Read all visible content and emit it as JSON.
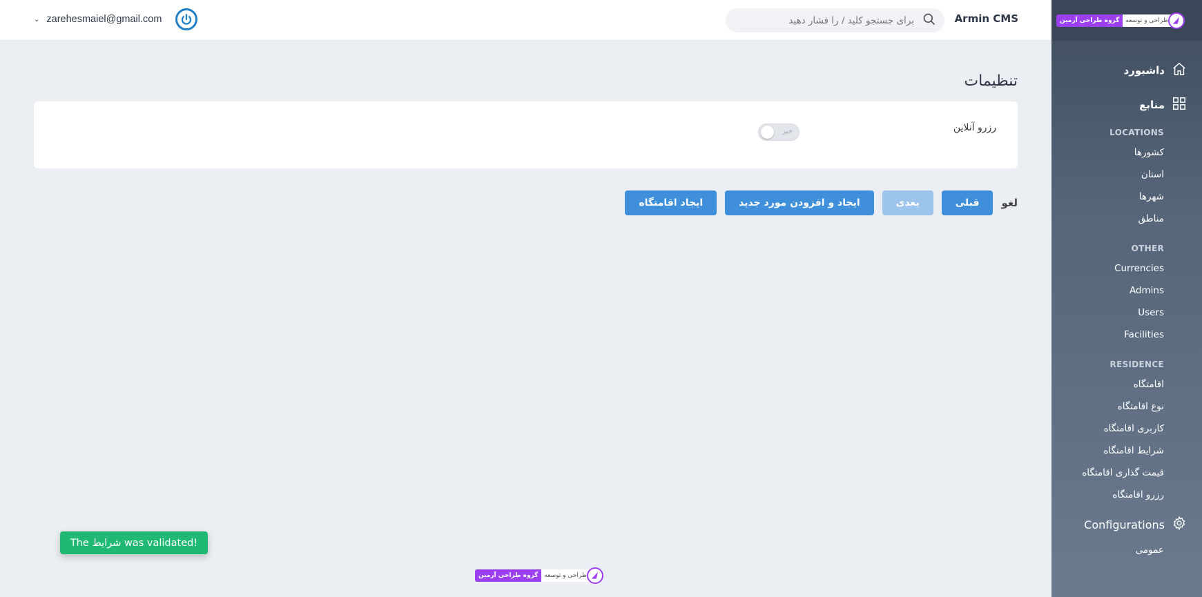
{
  "header": {
    "brand": "Armin CMS",
    "search_placeholder": "برای جستجو کلید / را فشار دهید",
    "user_email": "zarehesmaiel@gmail.com"
  },
  "sidebar": {
    "logo": {
      "purple_text": "گروه طراحی آرمین",
      "white_text": "طراحی و توسعه"
    },
    "dashboard": "داشبورد",
    "resources": "منابع",
    "sections": [
      {
        "title": "LOCATIONS",
        "items": [
          "کشورها",
          "استان",
          "شهرها",
          "مناطق"
        ]
      },
      {
        "title": "OTHER",
        "items": [
          "Currencies",
          "Admins",
          "Users",
          "Facilities"
        ]
      },
      {
        "title": "RESIDENCE",
        "items": [
          "اقامتگاه",
          "نوع اقامتگاه",
          "کاربری اقامتگاه",
          "شرایط اقامتگاه",
          "قیمت گذاری اقامتگاه",
          "رزرو اقامتگاه"
        ]
      }
    ],
    "configurations": "Configurations",
    "general": "عمومی"
  },
  "main": {
    "title": "تنظیمات",
    "field_label": "رزرو آنلاین",
    "toggle_label": "خیر",
    "toggle_on": false,
    "actions": {
      "cancel": "لغو",
      "previous": "قبلی",
      "next": "بعدی",
      "create_and_add": "ایجاد و افزودن مورد جدید",
      "create": "ایجاد اقامتگاه"
    }
  },
  "toast": "The شرایط was validated!",
  "footer_logo": {
    "purple_text": "گروه طراحی آرمین",
    "white_text": "طراحی و توسعه"
  },
  "colors": {
    "primary": "#3f8fdb",
    "success": "#1fb974",
    "sidebar": "#4a576b",
    "logo_purple": "#9b3ff0"
  }
}
